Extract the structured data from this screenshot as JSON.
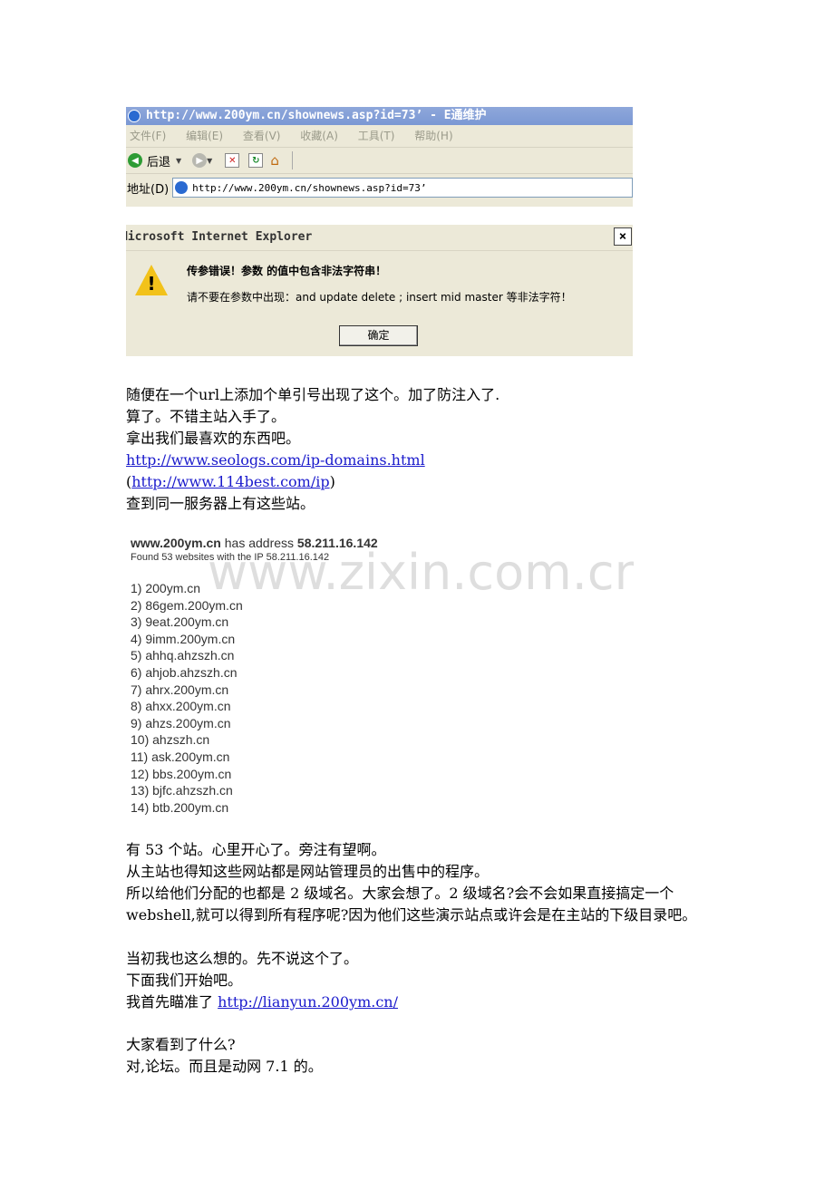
{
  "ie_window": {
    "title": "http://www.200ym.cn/shownews.asp?id=73’ - E通维护",
    "menu": [
      "文件(F)",
      "编辑(E)",
      "查看(V)",
      "收藏(A)",
      "工具(T)",
      "帮助(H)"
    ],
    "back_label": "后退",
    "address_label": "地址(D)",
    "address_value": "http://www.200ym.cn/shownews.asp?id=73’"
  },
  "dialog": {
    "title": "Microsoft Internet Explorer",
    "close_label": "×",
    "message_line1": "传参错误！参数  的值中包含非法字符串！",
    "message_line2": "请不要在参数中出现：and update delete ; insert mid master 等非法字符！",
    "ok_label": "确定"
  },
  "text_block_1": [
    "随便在一个url上添加个单引号出现了这个。加了防注入了.",
    "算了。不错主站入手了。",
    "拿出我们最喜欢的东西吧。"
  ],
  "link_1": "http://www.seologs.com/ip-domains.html",
  "link_2_open": "(",
  "link_2": "http://www.114best.com/ip",
  "link_2_close": ")",
  "text_found": "查到同一服务器上有这些站。",
  "ip_lookup": {
    "domain": "www.200ym.cn",
    "has_address": " has address ",
    "ip": "58.211.16.142",
    "found_line": "Found 53 websites with the IP 58.211.16.142",
    "sites": [
      "1) 200ym.cn",
      "2) 86gem.200ym.cn",
      "3) 9eat.200ym.cn",
      "4) 9imm.200ym.cn",
      "5) ahhq.ahzszh.cn",
      "6) ahjob.ahzszh.cn",
      "7) ahrx.200ym.cn",
      "8) ahxx.200ym.cn",
      "9) ahzs.200ym.cn",
      "10) ahzszh.cn",
      "11) ask.200ym.cn",
      "12) bbs.200ym.cn",
      "13) bjfc.ahzszh.cn",
      "14) btb.200ym.cn"
    ],
    "watermark": "www.zixin.com.cn"
  },
  "text_block_2": {
    "line1": "有 53 个站。心里开心了。旁注有望啊。",
    "line2": "从主站也得知这些网站都是网站管理员的出售中的程序。",
    "line3": "所以给他们分配的也都是 2 级域名。大家会想了。2 级域名?会不会如果直接搞定一个 webshell,就可以得到所有程序呢?因为他们这些演示站点或许会是在主站的下级目录吧。",
    "line4": "当初我也这么想的。先不说这个了。",
    "line5": "下面我们开始吧。",
    "line6_prefix": "我首先瞄准了 ",
    "line6_link": "http://lianyun.200ym.cn/"
  },
  "text_block_3": [
    "大家看到了什么?",
    "对,论坛。而且是动网 7.1 的。"
  ]
}
